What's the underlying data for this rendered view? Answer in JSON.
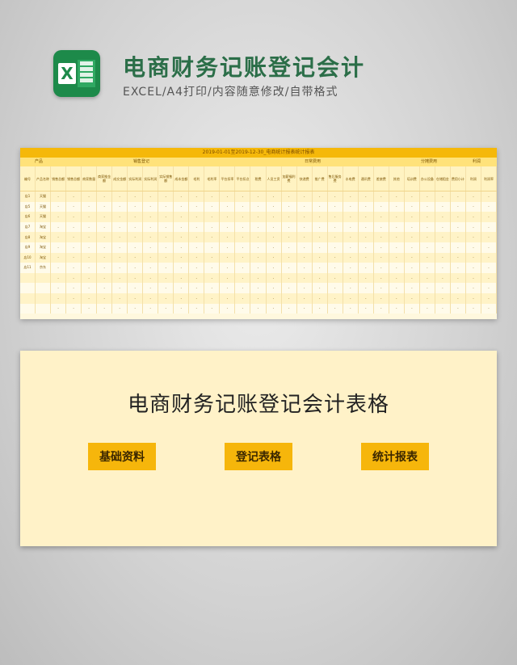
{
  "header": {
    "title": "电商财务记账登记会计",
    "subtitle": "EXCEL/A4打印/内容随意修改/自带格式",
    "logo_letter": "X"
  },
  "sheet": {
    "title": "2019-01-01至2019-12-30_电商统计报表统计报表",
    "sections": [
      "产品",
      "销售登记",
      "日常费用",
      "分摊费用",
      "利润"
    ],
    "columns": [
      "编号",
      "产品名称",
      "销售总额",
      "销售总额",
      "商家数量",
      "商家推金额",
      "成交金额",
      "实际利润",
      "实际利润",
      "实际销售额",
      "成本金额",
      "毛利",
      "毛利率",
      "平台扣率",
      "平台扣点",
      "税费",
      "人员工资",
      "加薪福利费",
      "快递费",
      "推广费",
      "售后服务费",
      "水电费",
      "通讯费",
      "差旅费",
      "其他",
      "培训费",
      "办公设备",
      "仓储租金",
      "费用小计",
      "利润",
      "利润率"
    ],
    "rows": [
      {
        "id": "店1",
        "name": "天猫"
      },
      {
        "id": "店5",
        "name": "天猫"
      },
      {
        "id": "店6",
        "name": "天猫"
      },
      {
        "id": "店7",
        "name": "淘宝"
      },
      {
        "id": "店8",
        "name": "淘宝"
      },
      {
        "id": "店9",
        "name": "淘宝"
      },
      {
        "id": "店10",
        "name": "淘宝"
      },
      {
        "id": "店11",
        "name": "京东"
      },
      {
        "id": "",
        "name": ""
      },
      {
        "id": "",
        "name": ""
      },
      {
        "id": "",
        "name": ""
      },
      {
        "id": "",
        "name": ""
      }
    ],
    "dash": "-"
  },
  "panel": {
    "title": "电商财务记账登记会计表格",
    "buttons": [
      "基础资料",
      "登记表格",
      "统计报表"
    ]
  },
  "colors": {
    "accent": "#f6b60b",
    "brand_green": "#1d8a4a",
    "title_green": "#2b6e48",
    "panel_bg": "#fff2c8"
  }
}
